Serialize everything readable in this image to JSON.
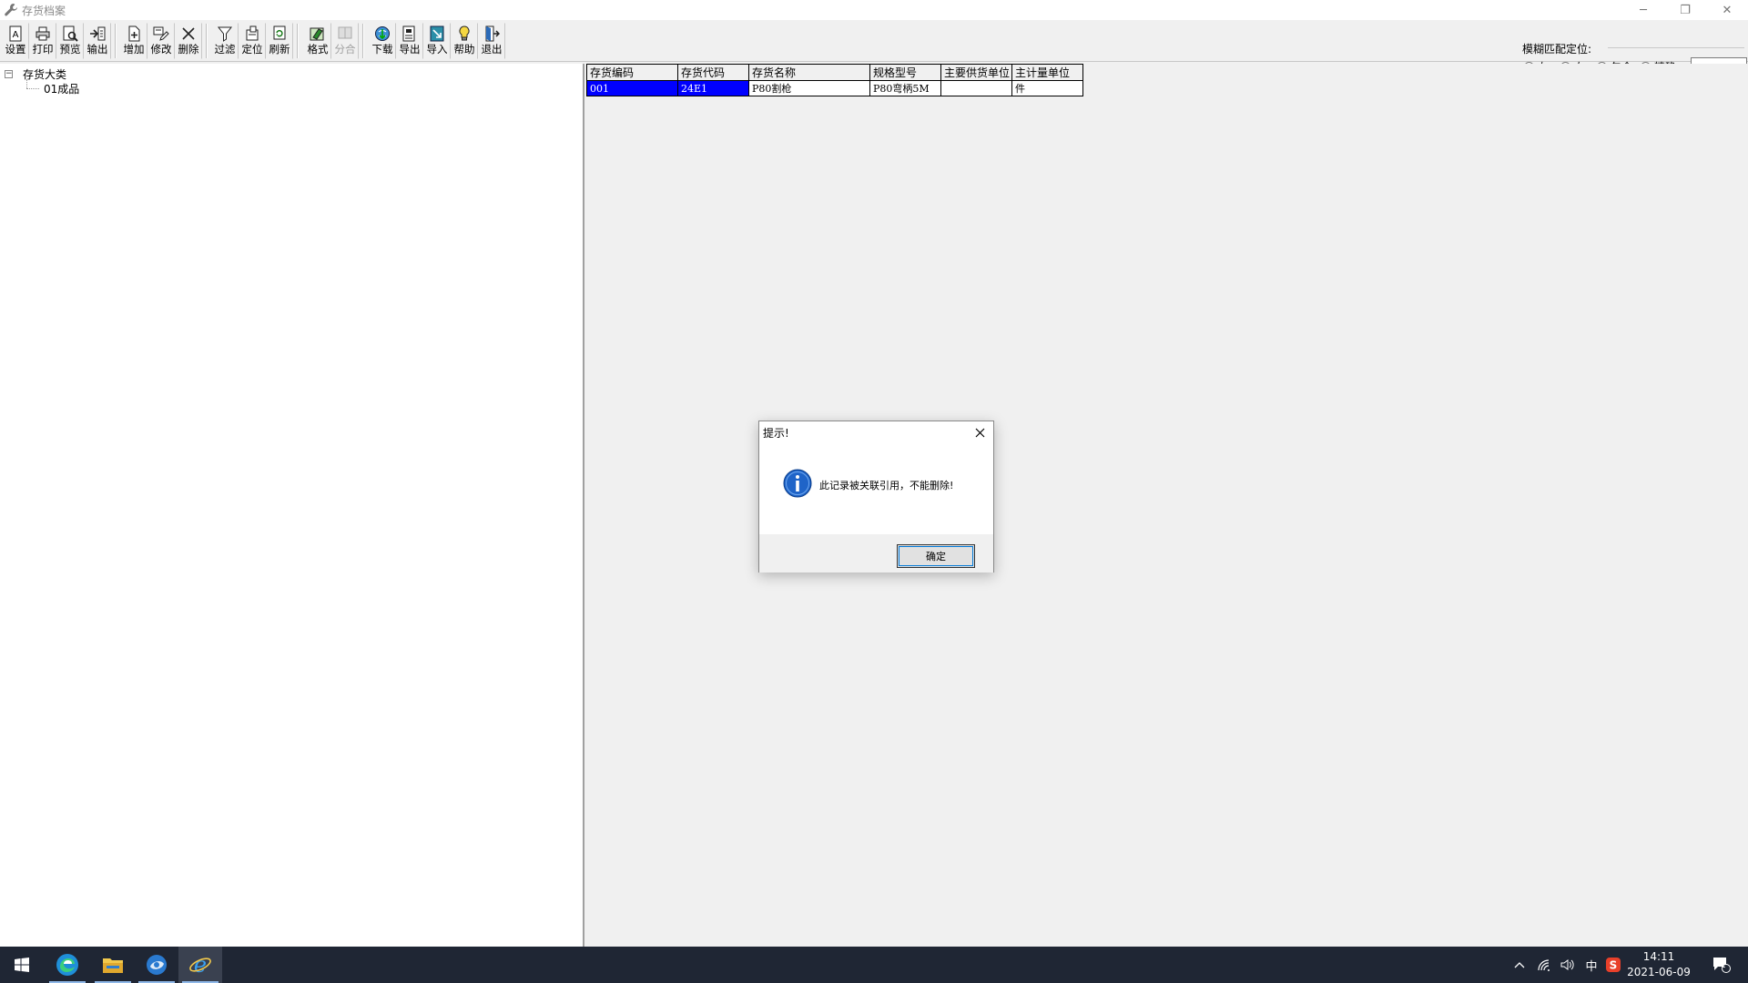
{
  "window": {
    "title": "存货档案",
    "minimize": "─",
    "restore": "❐",
    "close": "✕"
  },
  "toolbar": {
    "buttons": [
      {
        "id": "setup",
        "label": "设置",
        "icon": "page-setup-icon"
      },
      {
        "id": "print",
        "label": "打印",
        "icon": "printer-icon"
      },
      {
        "id": "preview",
        "label": "预览",
        "icon": "preview-icon"
      },
      {
        "id": "output",
        "label": "输出",
        "icon": "output-icon"
      },
      {
        "id": "add",
        "label": "增加",
        "icon": "add-icon"
      },
      {
        "id": "edit",
        "label": "修改",
        "icon": "edit-icon"
      },
      {
        "id": "delete",
        "label": "删除",
        "icon": "delete-icon"
      },
      {
        "id": "filter",
        "label": "过滤",
        "icon": "filter-icon"
      },
      {
        "id": "locate",
        "label": "定位",
        "icon": "locate-icon"
      },
      {
        "id": "refresh",
        "label": "刷新",
        "icon": "refresh-icon"
      },
      {
        "id": "format",
        "label": "格式",
        "icon": "format-icon"
      },
      {
        "id": "merge",
        "label": "分合",
        "icon": "merge-icon",
        "disabled": true
      },
      {
        "id": "download",
        "label": "下载",
        "icon": "download-icon"
      },
      {
        "id": "export",
        "label": "导出",
        "icon": "export-icon"
      },
      {
        "id": "import",
        "label": "导入",
        "icon": "import-icon"
      },
      {
        "id": "help",
        "label": "帮助",
        "icon": "help-icon"
      },
      {
        "id": "exit",
        "label": "退出",
        "icon": "exit-icon"
      }
    ]
  },
  "fuzzy_match": {
    "title": "模糊匹配定位:",
    "options": [
      {
        "label": "左",
        "selected": true
      },
      {
        "label": "右",
        "selected": false
      },
      {
        "label": "包含",
        "selected": false
      },
      {
        "label": "精确",
        "selected": false
      }
    ],
    "input_value": ""
  },
  "tree": {
    "root": {
      "label": "存货大类",
      "expander": "−"
    },
    "children": [
      {
        "label": "01成品"
      }
    ]
  },
  "grid": {
    "columns": [
      "存货编码",
      "存货代码",
      "存货名称",
      "规格型号",
      "主要供货单位",
      "主计量单位"
    ],
    "rows": [
      [
        "001",
        "24E1",
        "P80割枪",
        "P80弯柄5M",
        "",
        "件"
      ]
    ]
  },
  "dialog": {
    "title": "提示!",
    "message": "此记录被关联引用，不能删除!",
    "ok_label": "确定",
    "icon": "info-icon"
  },
  "taskbar": {
    "apps": [
      "windows-start-icon",
      "edge-icon",
      "file-explorer-icon",
      "app-icon",
      "ie-icon"
    ],
    "tray": {
      "ime": "中",
      "time": "14:11",
      "date": "2021-06-09",
      "notification_count": "1"
    }
  }
}
